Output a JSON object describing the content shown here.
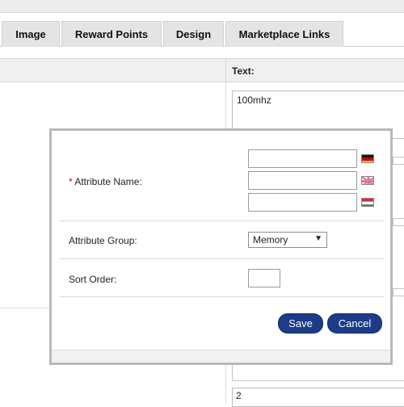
{
  "tabs": [
    {
      "label": "Image"
    },
    {
      "label": "Reward Points"
    },
    {
      "label": "Design"
    },
    {
      "label": "Marketplace Links"
    }
  ],
  "grid": {
    "text_header": "Text:",
    "first_value": "100mhz",
    "last_value": "2"
  },
  "dialog": {
    "attribute_name": {
      "required_marker": "*",
      "label": "Attribute Name:"
    },
    "attribute_group": {
      "label": "Attribute Group:",
      "selected": "Memory"
    },
    "sort_order": {
      "label": "Sort Order:",
      "value": ""
    },
    "save_label": "Save",
    "cancel_label": "Cancel"
  },
  "icons": {
    "dropdown_arrow": "▼"
  }
}
